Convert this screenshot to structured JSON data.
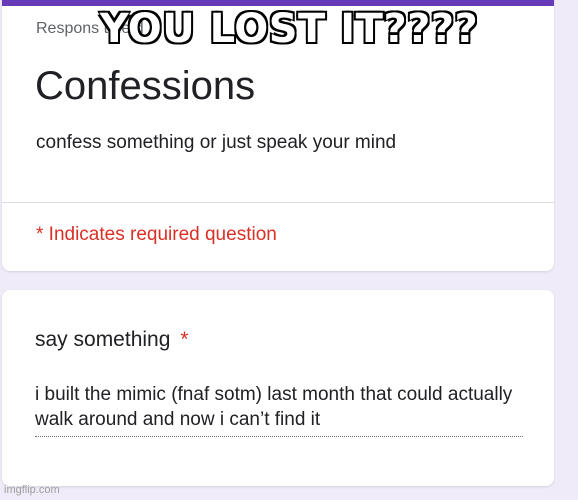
{
  "header": {
    "responses_note": "Respons          t     he     d       ",
    "title": "Confessions",
    "description": "confess something or just speak your mind",
    "required_note": "* Indicates required question"
  },
  "question": {
    "title": "say something",
    "required_marker": "*",
    "answer": "i built the mimic (fnaf sotm) last month that could actually walk around and now i can’t find it"
  },
  "overlay": {
    "caption": "YOU LOST IT????"
  },
  "watermark": "imgflip.com",
  "colors": {
    "accent": "#673ab7",
    "background": "#f0ebf8",
    "required": "#d93025"
  }
}
